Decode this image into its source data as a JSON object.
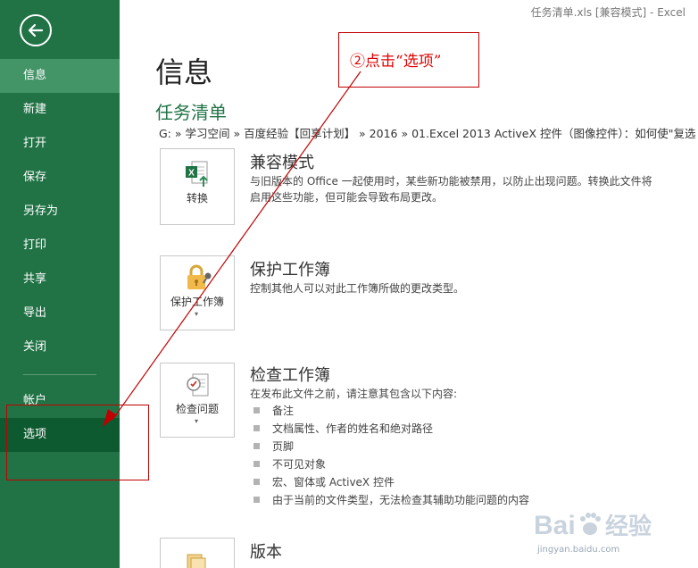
{
  "window": {
    "title": "任务清单.xls  [兼容模式] - Excel"
  },
  "sidebar": {
    "back_icon": "back-arrow-icon",
    "items": [
      {
        "label": "信息",
        "state": "active"
      },
      {
        "label": "新建"
      },
      {
        "label": "打开"
      },
      {
        "label": "保存"
      },
      {
        "label": "另存为"
      },
      {
        "label": "打印"
      },
      {
        "label": "共享"
      },
      {
        "label": "导出"
      },
      {
        "label": "关闭"
      },
      {
        "label": "帐户"
      },
      {
        "label": "选项",
        "state": "selected"
      }
    ],
    "color": "#217346"
  },
  "main": {
    "title": "信息",
    "doc_name": "任务清单",
    "path": "G: » 学习空间 » 百度经验【回享计划】 » 2016 » 01.Excel 2013 ActiveX 控件（图像控件）：如何使\"复选",
    "sections": [
      {
        "button_label": "转换",
        "icon": "excel-convert-icon",
        "heading": "兼容模式",
        "desc_lines": [
          "与旧版本的 Office 一起使用时，某些新功能被禁用，以防止出现问题。转换此文件将",
          "启用这些功能，但可能会导致布局更改。"
        ]
      },
      {
        "button_label": "保护工作簿",
        "icon": "lock-key-icon",
        "heading": "保护工作簿",
        "desc_lines": [
          "控制其他人可以对此工作簿所做的更改类型。"
        ]
      },
      {
        "button_label": "检查问题",
        "icon": "inspect-document-icon",
        "heading": "检查工作簿",
        "desc_lines": [
          "在发布此文件之前，请注意其包含以下内容:"
        ],
        "bullets": [
          "备注",
          "文档属性、作者的姓名和绝对路径",
          "页脚",
          "不可见对象",
          "宏、窗体或 ActiveX 控件",
          "由于当前的文件类型，无法检查其辅助功能问题的内容"
        ]
      },
      {
        "icon": "versions-icon",
        "heading": "版本"
      }
    ]
  },
  "annotation": {
    "callout_text": "②点击“选项”",
    "color": "#c00000"
  },
  "watermark": {
    "brand": "Bai 经验",
    "url": "jingyan.baidu.com"
  }
}
